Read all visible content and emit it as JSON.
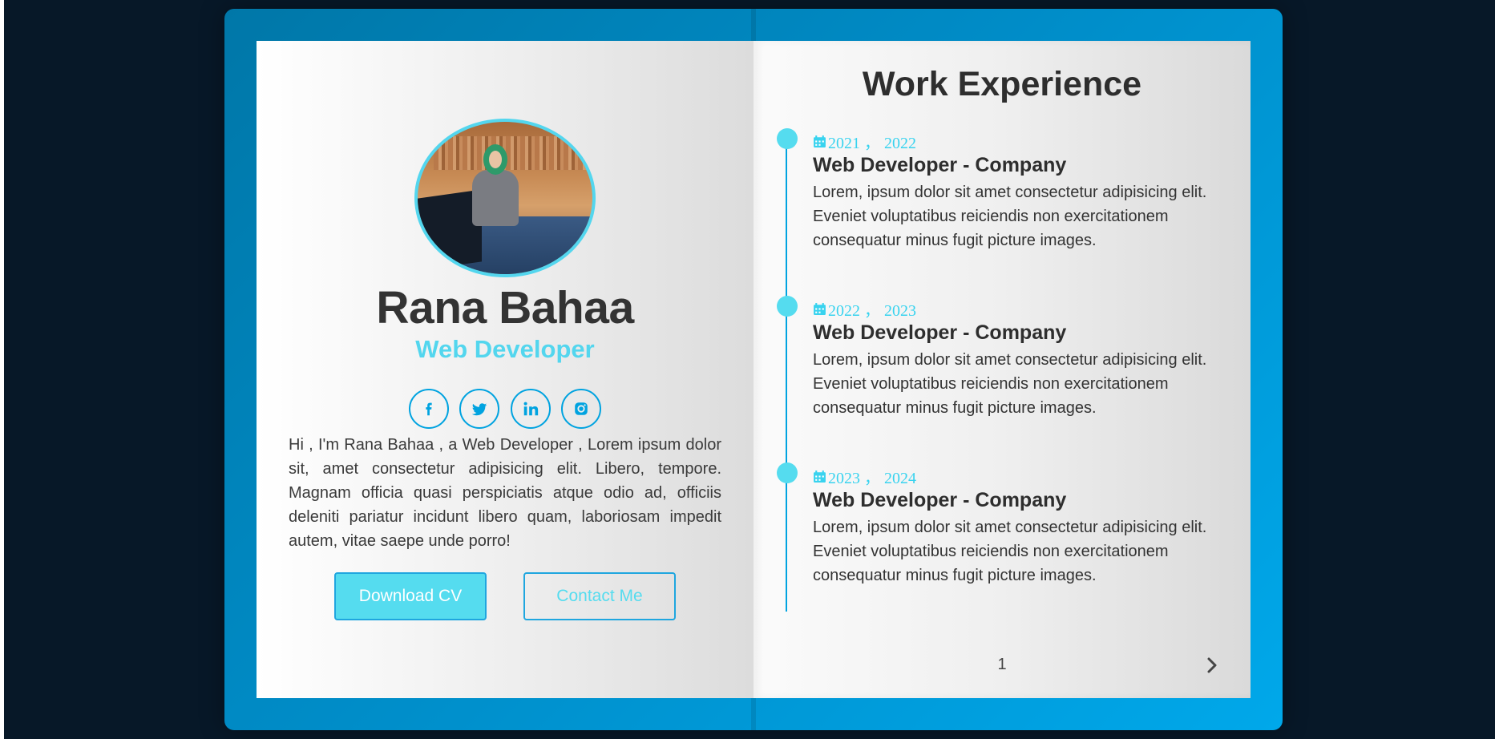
{
  "profile": {
    "name": "Rana Bahaa",
    "role": "Web Developer",
    "bio": "Hi , I'm Rana Bahaa , a Web Developer , Lorem ipsum dolor sit, amet consectetur adipisicing elit. Libero, tempore. Magnam officia quasi perspiciatis atque odio ad, officiis deleniti pariatur incidunt libero quam, laboriosam impedit autem, vitae saepe unde porro!",
    "avatar_icon": "profile-photo"
  },
  "socials": [
    {
      "icon": "facebook-icon"
    },
    {
      "icon": "twitter-icon"
    },
    {
      "icon": "linkedin-icon"
    },
    {
      "icon": "instagram-icon"
    }
  ],
  "buttons": {
    "download_label": "Download CV",
    "contact_label": "Contact Me"
  },
  "experience": {
    "title": "Work Experience",
    "items": [
      {
        "date": "2021 ， 2022",
        "title": "Web Developer - Company",
        "description": "Lorem, ipsum dolor sit amet consectetur adipisicing elit. Eveniet voluptatibus reiciendis non exercitationem consequatur minus fugit picture images."
      },
      {
        "date": "2022 ， 2023",
        "title": "Web Developer - Company",
        "description": "Lorem, ipsum dolor sit amet consectetur adipisicing elit. Eveniet voluptatibus reiciendis non exercitationem consequatur minus fugit picture images."
      },
      {
        "date": "2023 ， 2024",
        "title": "Web Developer - Company",
        "description": "Lorem, ipsum dolor sit amet consectetur adipisicing elit. Eveniet voluptatibus reiciendis non exercitationem consequatur minus fugit picture images."
      }
    ]
  },
  "pagination": {
    "page_number": "1",
    "next_icon": "chevron-right-icon"
  },
  "colors": {
    "background": "#071828",
    "book": "#0095d5",
    "accent": "#55dcef",
    "accent_border": "#00a3e0",
    "text": "#333333"
  }
}
